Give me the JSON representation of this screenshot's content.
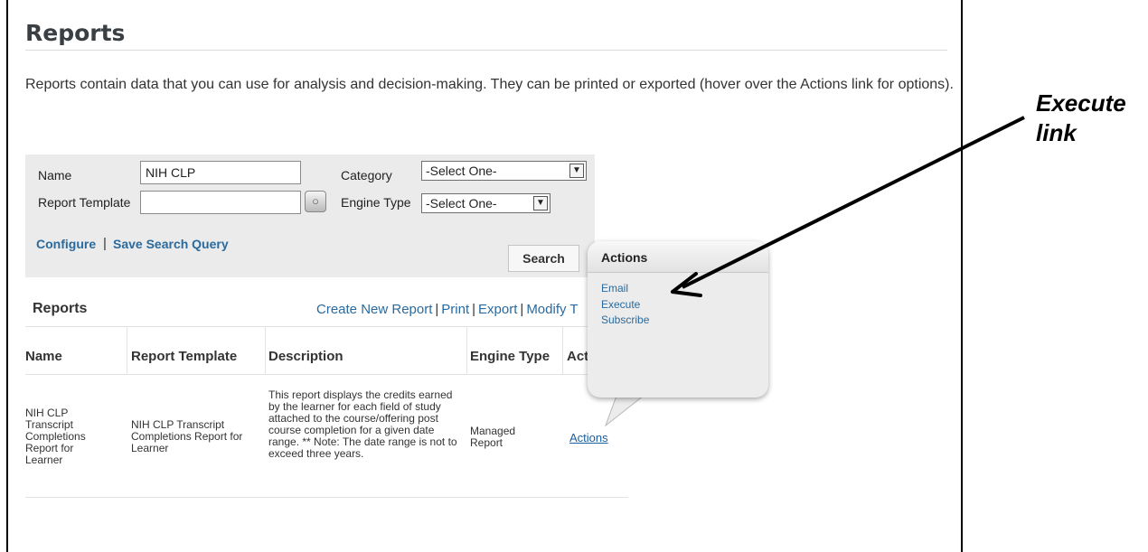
{
  "page": {
    "title": "Reports",
    "intro": "Reports contain data that you can use for analysis and decision-making. They can be printed or exported (hover over the Actions link for options)."
  },
  "search": {
    "name_label": "Name",
    "name_value": "NIH CLP",
    "category_label": "Category",
    "category_selected": "-Select One-",
    "report_template_label": "Report Template",
    "report_template_value": "",
    "engine_type_label": "Engine Type",
    "engine_type_selected": "-Select One-",
    "configure_link": "Configure",
    "save_query_link": "Save Search Query",
    "search_button": "Search",
    "separator": "|"
  },
  "results": {
    "heading": "Reports",
    "links": [
      "Create New Report",
      "Print",
      "Export",
      "Modify T"
    ],
    "columns": [
      "Name",
      "Report Template",
      "Description",
      "Engine Type",
      "Acti"
    ],
    "rows": [
      {
        "name": "NIH CLP Transcript Completions Report for Learner",
        "report_template": "NIH CLP Transcript Completions Report for Learner",
        "description": "This report displays the credits earned by the learner for each field of study attached to the course/offering post course completion for a given date range. ** Note: The date range is not to exceed three years.",
        "engine_type": "Managed Report",
        "actions_link": "Actions"
      }
    ]
  },
  "actions_popup": {
    "title": "Actions",
    "items": [
      "Email",
      "Execute",
      "Subscribe"
    ]
  },
  "annotation": {
    "line1": "Execute",
    "line2": "link"
  }
}
